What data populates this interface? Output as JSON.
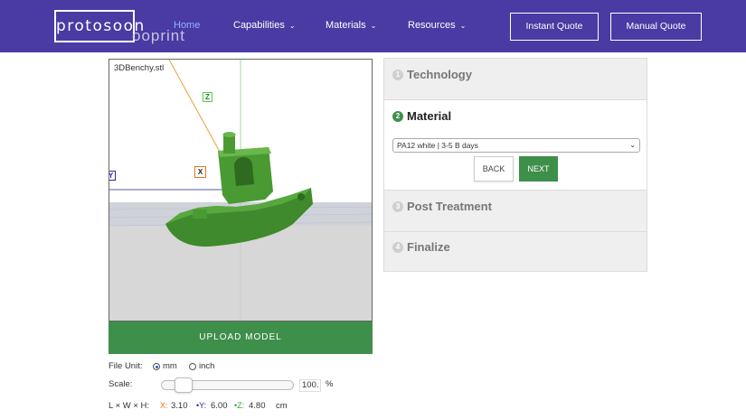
{
  "brand": {
    "logo": "protosoon",
    "ghost_text": "ooprint"
  },
  "nav": {
    "items": [
      {
        "label": "Home",
        "dropdown": false
      },
      {
        "label": "Capabilities",
        "dropdown": true
      },
      {
        "label": "Materials",
        "dropdown": true
      },
      {
        "label": "Resources",
        "dropdown": true
      }
    ],
    "instant_quote": "Instant Quote",
    "manual_quote": "Manual Quote"
  },
  "viewer": {
    "filename": "3DBenchy.stl",
    "axis_labels": {
      "x": "X",
      "y": "Y",
      "z": "Z"
    },
    "upload_label": "UPLOAD MODEL"
  },
  "controls": {
    "file_unit_label": "File Unit:",
    "unit_mm": "mm",
    "unit_inch": "inch",
    "selected_unit": "mm",
    "scale_label": "Scale:",
    "scale_value": "100.",
    "scale_unit": "%",
    "dims_label": "L × W × H:",
    "dim_x_prefix": "X:",
    "dim_x": "3.10",
    "dim_y_prefix": "•Y:",
    "dim_y": "6.00",
    "dim_z_prefix": "•Z:",
    "dim_z": "4.80",
    "dims_unit": "cm"
  },
  "steps": [
    {
      "num": "1",
      "title": "Technology",
      "active": false
    },
    {
      "num": "2",
      "title": "Material",
      "active": true
    },
    {
      "num": "3",
      "title": "Post Treatment",
      "active": false
    },
    {
      "num": "4",
      "title": "Finalize",
      "active": false
    }
  ],
  "material": {
    "selected": "PA12 white | 3-5 B days",
    "back_label": "BACK",
    "next_label": "NEXT"
  },
  "colors": {
    "header": "#4a3aa3",
    "accent_green": "#3e8f4a",
    "nav_active": "#8fb4ff",
    "model_green": "#3f8a2c",
    "axis_x": "#e07a1f",
    "axis_y": "#2a2a9a",
    "axis_z": "#58c858"
  }
}
